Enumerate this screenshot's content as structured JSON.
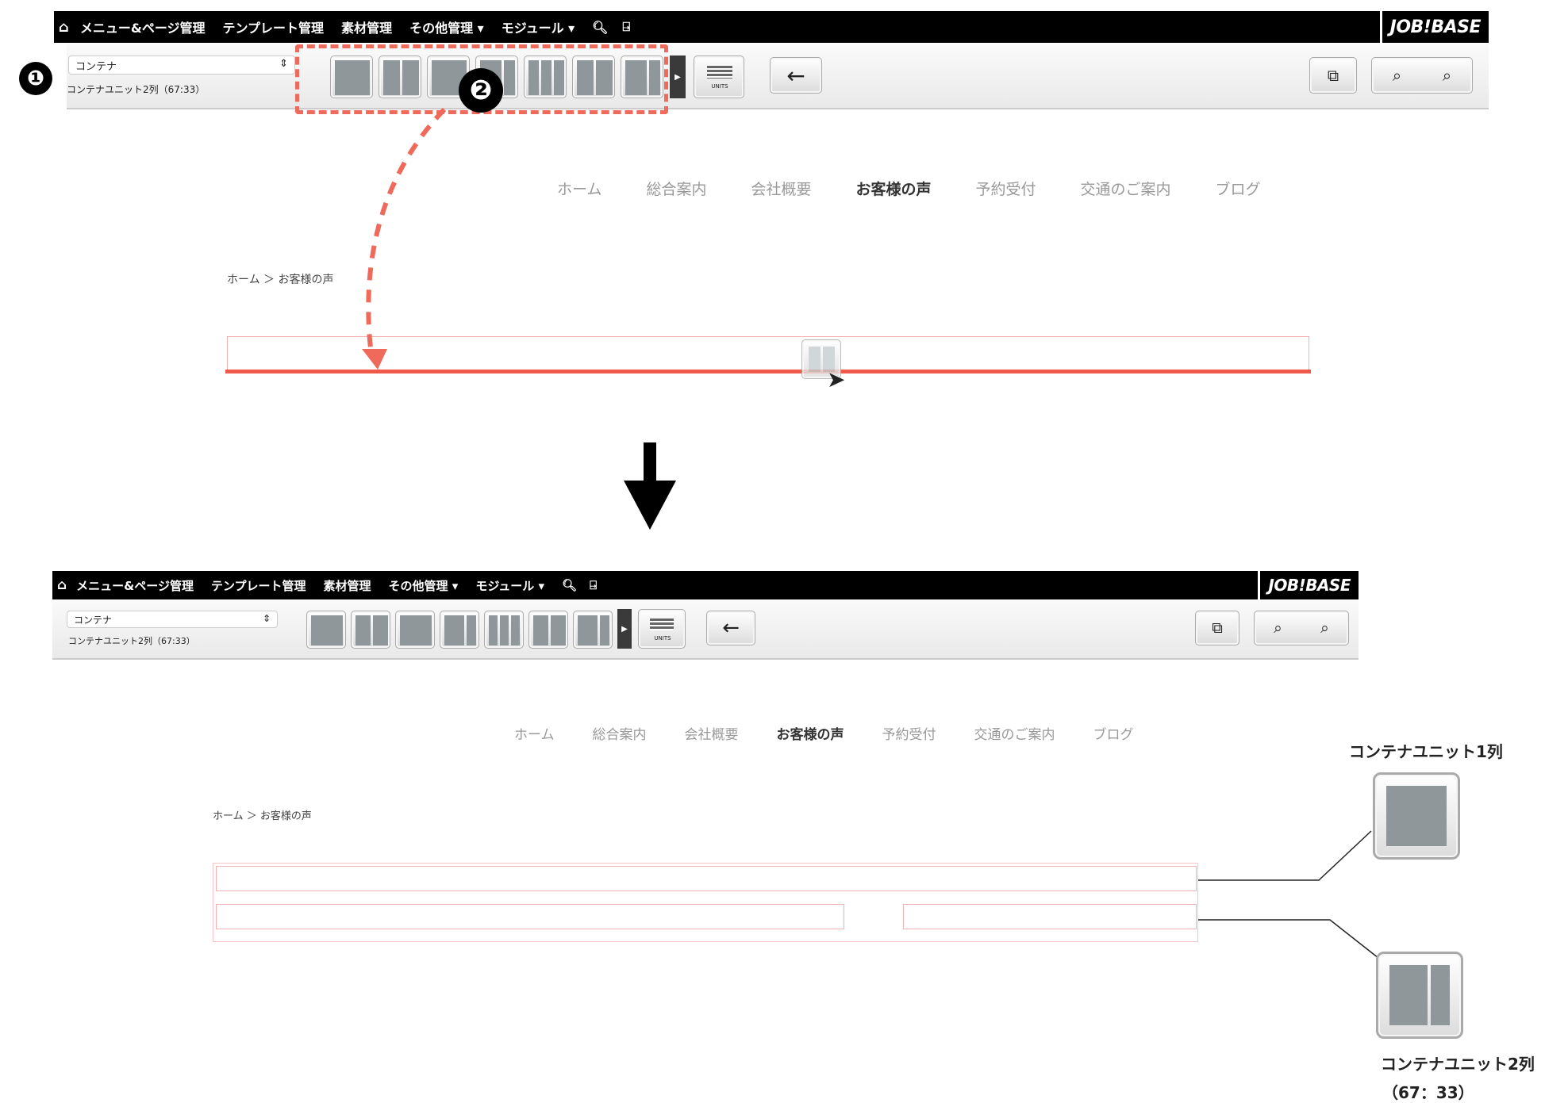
{
  "menu": {
    "home_icon": "home-icon",
    "items": [
      "メニュー&ページ管理",
      "テンプレート管理",
      "素材管理",
      "その他管理 ▾",
      "モジュール ▾"
    ],
    "search_icon": "search-icon",
    "exit_icon": "exit-icon",
    "logo": "JOB!BASE"
  },
  "toolbar": {
    "select_value": "コンテナ",
    "unit_value": "コンテナユニット2列（67:33）",
    "back_label": "←",
    "width_label": "UNITS"
  },
  "site_nav": [
    "ホーム",
    "総合案内",
    "会社概要",
    "お客様の声",
    "予約受付",
    "交通のご案内",
    "ブログ"
  ],
  "breadcrumb": "ホーム ＞ お客様の声",
  "steps": [
    "❶",
    "❷"
  ],
  "legend": {
    "unit1": "コンテナユニット1列",
    "unit2": "コンテナユニット2列",
    "unit2_ratio": "（67：33）"
  },
  "colors": {
    "accent": "#f15a4a",
    "dashed": "#ef6a5a"
  }
}
